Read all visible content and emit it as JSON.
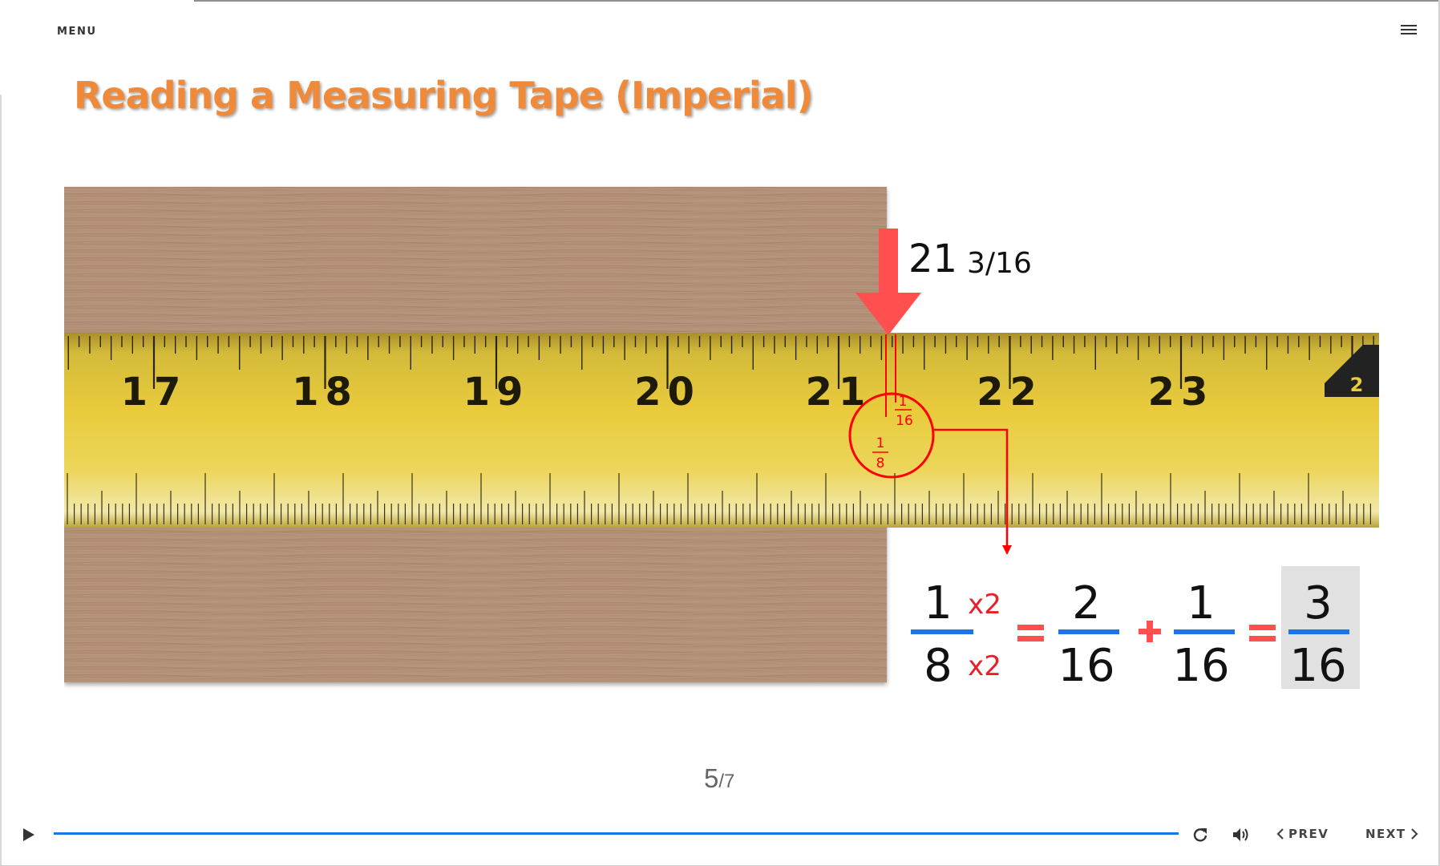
{
  "header": {
    "menu_label": "MENU",
    "menu_icon": "hamburger-menu-icon"
  },
  "slide": {
    "title": "Reading a Measuring Tape (Imperial)",
    "measurement_whole": "21",
    "measurement_fraction": "3/16",
    "tape_numbers": [
      "17",
      "18",
      "19",
      "20",
      "21",
      "22",
      "23"
    ],
    "corner_badge": "2",
    "zoom_sixteenth_num": "1",
    "zoom_sixteenth_den": "16",
    "zoom_eighth_num": "1",
    "zoom_eighth_den": "8",
    "equation": {
      "f1_num": "1",
      "f1_den": "8",
      "mult_top": "x2",
      "mult_bottom": "x2",
      "equals": "=",
      "f2_num": "2",
      "f2_den": "16",
      "plus": "+",
      "f3_num": "1",
      "f3_den": "16",
      "f4_num": "3",
      "f4_den": "16"
    },
    "colors": {
      "title": "#ef8a3b",
      "tape": "#e8c938",
      "wood": "#b49075",
      "arrow": "#ff4f4f",
      "annotation": "#ff0000",
      "fraction_bar": "#1b74e8"
    }
  },
  "player": {
    "current_slide": "5",
    "total_slides": "/7",
    "progress": 1.0,
    "prev_label": "PREV",
    "next_label": "NEXT",
    "icons": [
      "play-icon",
      "replay-icon",
      "volume-icon",
      "chevron-left-icon",
      "chevron-right-icon"
    ]
  }
}
